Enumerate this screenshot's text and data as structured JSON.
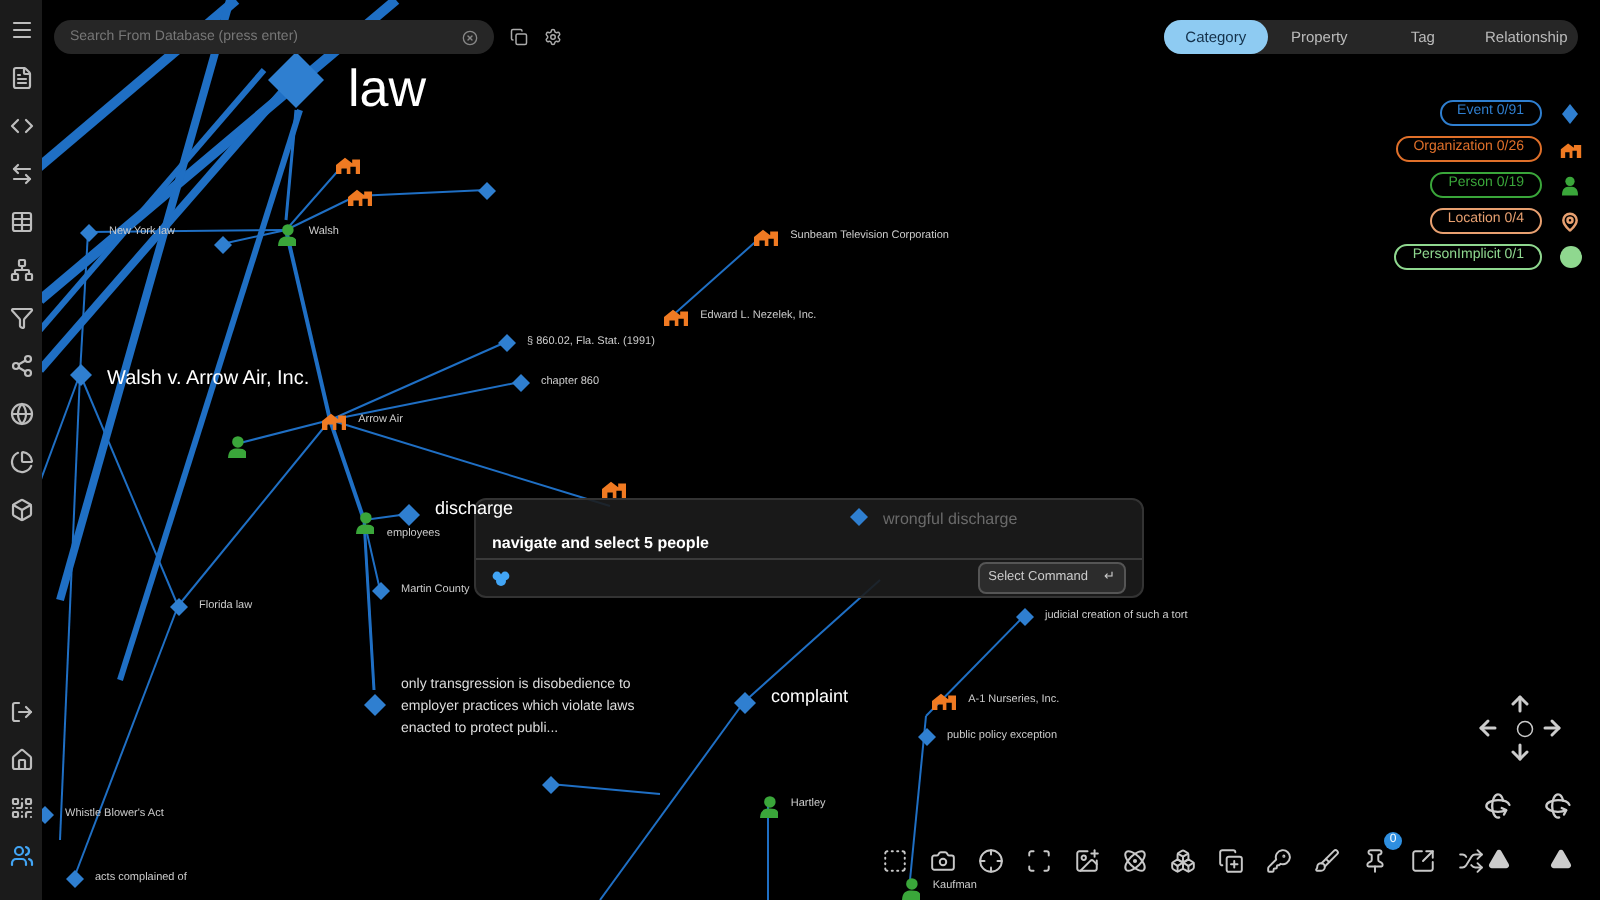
{
  "search": {
    "placeholder": "Search From Database (press enter)"
  },
  "tabs": [
    {
      "label": "Category",
      "selected": true
    },
    {
      "label": "Property",
      "selected": false
    },
    {
      "label": "Tag",
      "selected": false
    },
    {
      "label": "Relationship",
      "selected": false
    }
  ],
  "legend": [
    {
      "label": "Event 0/91",
      "kind": "event",
      "color": "#2f7fd0"
    },
    {
      "label": "Organization 0/26",
      "kind": "organization",
      "color": "#e0702a"
    },
    {
      "label": "Person 0/19",
      "kind": "person",
      "color": "#3aa63a"
    },
    {
      "label": "Location 0/4",
      "kind": "location",
      "color": "#e8a070"
    },
    {
      "label": "PersonImplicit 0/1",
      "kind": "person_implicit",
      "color": "#8fd88f"
    }
  ],
  "graph": {
    "nodes": [
      {
        "kind": "event",
        "label": "law"
      },
      {
        "kind": "organization"
      },
      {
        "kind": "event"
      },
      {
        "kind": "organization"
      },
      {
        "kind": "event",
        "label": "New York law"
      },
      {
        "kind": "person",
        "label": "Walsh"
      },
      {
        "kind": "organization",
        "label": "Sunbeam Television Corporation"
      },
      {
        "kind": "event"
      },
      {
        "kind": "organization",
        "label": "Edward L. Nezelek, Inc."
      },
      {
        "kind": "event",
        "label": "§ 860.02, Fla. Stat. (1991)"
      },
      {
        "kind": "event",
        "label": "Walsh v. Arrow Air, Inc."
      },
      {
        "kind": "event",
        "label": "chapter 860"
      },
      {
        "kind": "organization",
        "label": "Arrow Air"
      },
      {
        "kind": "person"
      },
      {
        "kind": "organization"
      },
      {
        "kind": "event",
        "label": "discharge"
      },
      {
        "kind": "event",
        "label": "wrongful discharge"
      },
      {
        "kind": "person",
        "label": "employees"
      },
      {
        "kind": "event",
        "label": "Martin County"
      },
      {
        "kind": "event",
        "label": "Florida law"
      },
      {
        "kind": "event",
        "label": "judicial creation of such a tort"
      },
      {
        "kind": "event",
        "label": "only transgression is disobedience to employer practices which violate laws enacted to protect publi..."
      },
      {
        "kind": "event",
        "label": "complaint"
      },
      {
        "kind": "organization",
        "label": "A-1 Nurseries, Inc."
      },
      {
        "kind": "event",
        "label": "public policy exception"
      },
      {
        "kind": "event"
      },
      {
        "kind": "person",
        "label": "Hartley"
      },
      {
        "kind": "event",
        "label": "Whistle Blower's Act"
      },
      {
        "kind": "event",
        "label": "acts complained of"
      },
      {
        "kind": "person",
        "label": "Kaufman"
      }
    ]
  },
  "command_palette": {
    "title": "navigate and select 5 people",
    "button": "Select Command",
    "button_key": "↵"
  },
  "toolbar": {
    "pin_badge": "0"
  }
}
